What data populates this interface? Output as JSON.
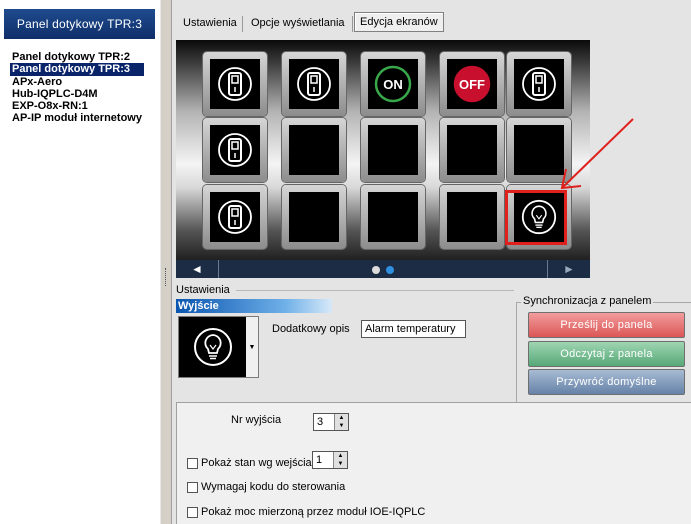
{
  "tree": {
    "header": "Panel dotykowy TPR:3",
    "items": [
      "Panel dotykowy TPR:2",
      "Panel dotykowy TPR:3",
      "APx-Aero",
      "Hub-IQPLC-D4M",
      "EXP-O8x-RN:1",
      "AP-IP moduł internetowy"
    ],
    "selected_index": 1
  },
  "tabs": [
    "Ustawienia",
    "Opcje wyświetlania",
    "Edycja ekranów"
  ],
  "active_tab": "Edycja ekranów",
  "screen": {
    "tiles": [
      [
        "switch",
        "switch",
        "on",
        "off",
        "switch"
      ],
      [
        "switch",
        "empty",
        "empty",
        "empty",
        "empty"
      ],
      [
        "switch",
        "empty",
        "empty",
        "empty",
        "bulb"
      ]
    ],
    "on_label": "ON",
    "off_label": "OFF",
    "selected_tile": "bulb",
    "nav_prev": "◄",
    "nav_next": "►"
  },
  "settings": {
    "group_title": "Ustawienia",
    "header": "Wyjście",
    "icon": "bulb-icon",
    "desc_label": "Dodatkowy opis",
    "desc_value": "Alarm temperatury"
  },
  "sync": {
    "title": "Synchronizacja z panelem",
    "send": "Prześlij do panela",
    "read": "Odczytaj z panela",
    "reset": "Przywróć domyślne"
  },
  "options": {
    "nr_label": "Nr wyjścia",
    "nr_value": "3",
    "show_state_label": "Pokaż stan wg wejścia",
    "show_state_value": "1",
    "require_code_label": "Wymagaj kodu do sterowania",
    "show_power_label": "Pokaż moc mierzoną przez moduł IOE-IQPLC"
  },
  "colors": {
    "on": "#39a84a",
    "off": "#c8102e",
    "highlight": "#e0201c"
  }
}
